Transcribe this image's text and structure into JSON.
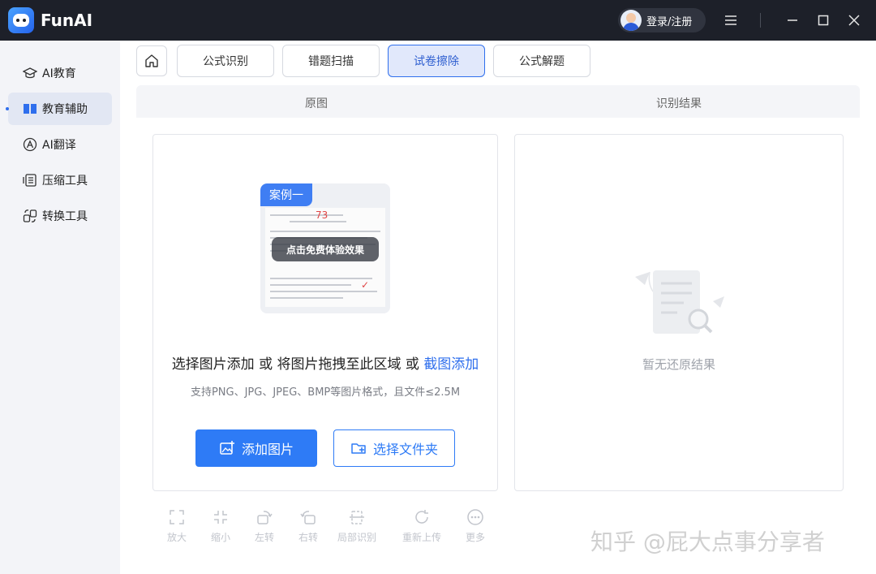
{
  "app": {
    "name": "FunAI"
  },
  "titlebar": {
    "login_label": "登录/注册"
  },
  "sidebar": {
    "items": [
      {
        "label": "AI教育",
        "icon": "graduation-cap-icon"
      },
      {
        "label": "教育辅助",
        "icon": "book-icon",
        "active": true
      },
      {
        "label": "AI翻译",
        "icon": "translate-icon"
      },
      {
        "label": "压缩工具",
        "icon": "compress-icon"
      },
      {
        "label": "转换工具",
        "icon": "convert-icon"
      }
    ]
  },
  "tabs": [
    {
      "label": "公式识别"
    },
    {
      "label": "错题扫描"
    },
    {
      "label": "试卷擦除",
      "active": true
    },
    {
      "label": "公式解题"
    }
  ],
  "subheader": {
    "left": "原图",
    "right": "识别结果"
  },
  "upload": {
    "example_tag": "案例一",
    "example_score": "73",
    "example_cta": "点击免费体验效果",
    "prompt_prefix": "选择图片添加 或 将图片拖拽至此区域 或 ",
    "prompt_link": "截图添加",
    "formats_text": "支持PNG、JPG、JPEG、BMP等图片格式，且文件≤2.5M",
    "add_button": "添加图片",
    "folder_button": "选择文件夹"
  },
  "result": {
    "empty_text": "暂无还原结果"
  },
  "toolbar": [
    {
      "label": "放大",
      "icon": "zoom-in-icon"
    },
    {
      "label": "缩小",
      "icon": "zoom-out-icon"
    },
    {
      "label": "左转",
      "icon": "rotate-left-icon"
    },
    {
      "label": "右转",
      "icon": "rotate-right-icon"
    },
    {
      "label": "局部识别",
      "icon": "crop-icon"
    },
    {
      "label": "重新上传",
      "icon": "reupload-icon"
    },
    {
      "label": "更多",
      "icon": "more-icon"
    }
  ],
  "watermark": "知乎 @屁大点事分享者",
  "colors": {
    "accent": "#2e7bf6",
    "titlebar": "#1d2029",
    "active_tab_bg": "#e1e8fb"
  }
}
